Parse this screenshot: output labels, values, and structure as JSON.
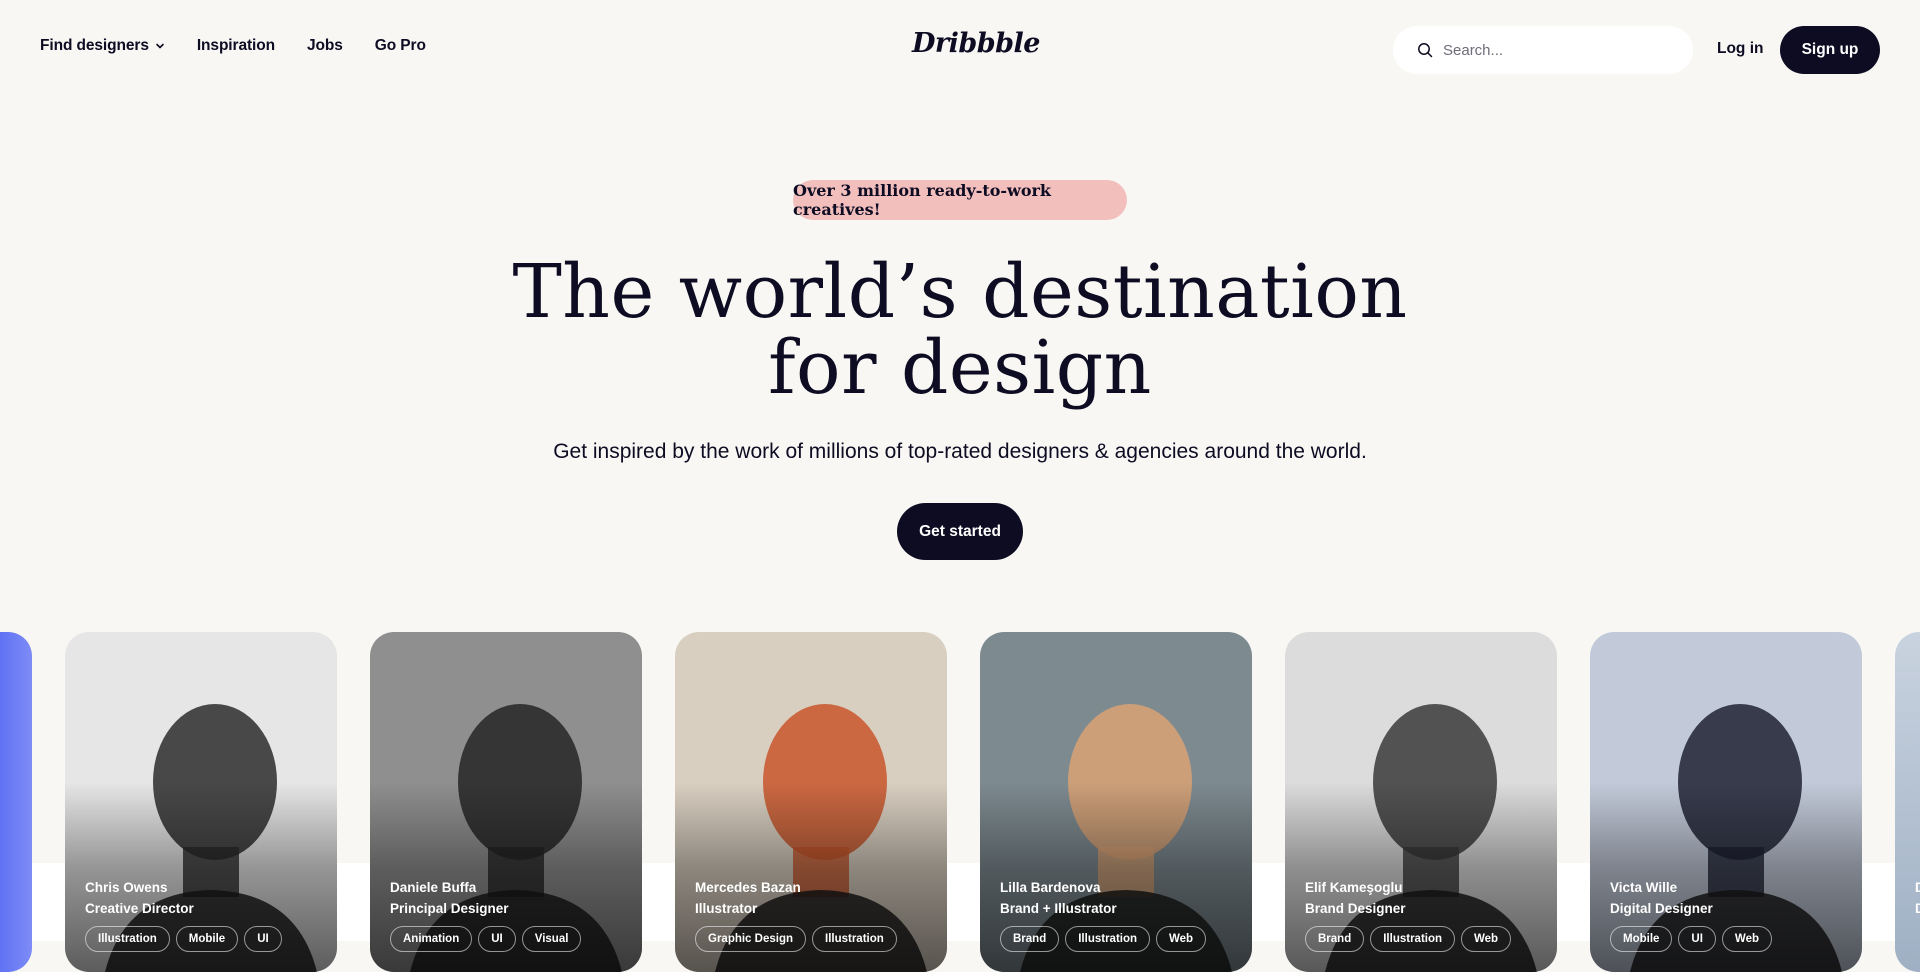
{
  "header": {
    "nav": [
      {
        "label": "Find designers",
        "has_dropdown": true
      },
      {
        "label": "Inspiration"
      },
      {
        "label": "Jobs"
      },
      {
        "label": "Go Pro"
      }
    ],
    "logo": "Dribbble",
    "search": {
      "placeholder": "Search..."
    },
    "login_label": "Log in",
    "signup_label": "Sign up"
  },
  "hero": {
    "badge": "Over 3 million ready-to-work creatives!",
    "headline_line1": "The world’s destination",
    "headline_line2": "for design",
    "subheadline": "Get inspired by the work of millions of top-rated designers & agencies around the world.",
    "cta_label": "Get started"
  },
  "designers": [
    {
      "name": "Chris Owens",
      "role": "Creative Director",
      "tags": [
        "Illustration",
        "Mobile",
        "UI"
      ],
      "bg": "#e6e6e6",
      "tone": "#2b2b2b"
    },
    {
      "name": "Daniele Buffa",
      "role": "Principal Designer",
      "tags": [
        "Animation",
        "UI",
        "Visual"
      ],
      "bg": "#8f8f8f",
      "tone": "#262626"
    },
    {
      "name": "Mercedes Bazan",
      "role": "Illustrator",
      "tags": [
        "Graphic Design",
        "Illustration"
      ],
      "bg": "#d9cfc1",
      "tone": "#c8562a"
    },
    {
      "name": "Lilla Bardenova",
      "role": "Brand + Illustrator",
      "tags": [
        "Brand",
        "Illustration",
        "Web"
      ],
      "bg": "#7d8a90",
      "tone": "#d9a276"
    },
    {
      "name": "Elif Kameşoglu",
      "role": "Brand Designer",
      "tags": [
        "Brand",
        "Illustration",
        "Web"
      ],
      "bg": "#dcdcdc",
      "tone": "#3a3a3a"
    },
    {
      "name": "Victa Wille",
      "role": "Digital Designer",
      "tags": [
        "Mobile",
        "UI",
        "Web"
      ],
      "bg": "#c2cad9",
      "tone": "#1e2233"
    }
  ],
  "edge_right": {
    "name": "D",
    "role": "D"
  }
}
